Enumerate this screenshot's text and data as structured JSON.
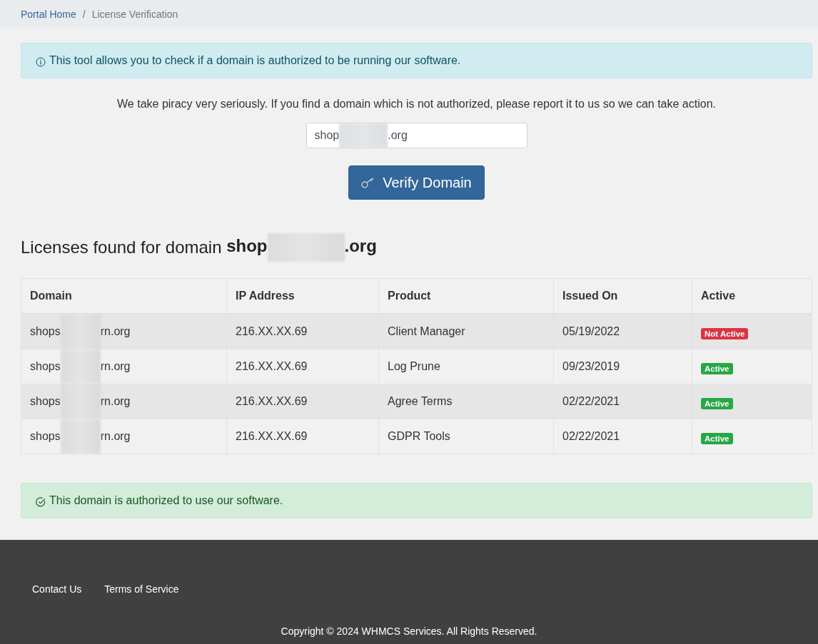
{
  "breadcrumb_separator": "/",
  "breadcrumb": [
    {
      "label": "Portal Home",
      "kind": "link"
    },
    {
      "label": "License Verification",
      "kind": "current"
    }
  ],
  "info_alert": {
    "kind": "info",
    "text": "This tool allows you to check if a domain is authorized to be running our software."
  },
  "notice": "We take piracy very seriously. If you find a domain which is not authorized, please report it to us so we can take action.",
  "domain_field": {
    "value_before": "shop",
    "value_after": ".org"
  },
  "verify_button": "Verify Domain",
  "heading": {
    "text": "Licenses found for domain",
    "domain_before": "shop",
    "domain_after": ".org"
  },
  "table": {
    "columns": [
      "Domain",
      "IP Address",
      "Product",
      "Issued On",
      "Active"
    ],
    "rows": [
      {
        "domain_before": "shops",
        "domain_after": "rn.org",
        "ip": "216.XX.XX.69",
        "product": "Client Manager",
        "issued": "05/19/2022",
        "status": "Not Active",
        "active": false
      },
      {
        "domain_before": "shops",
        "domain_after": "rn.org",
        "ip": "216.XX.XX.69",
        "product": "Log Prune",
        "issued": "09/23/2019",
        "status": "Active",
        "active": true
      },
      {
        "domain_before": "shops",
        "domain_after": "rn.org",
        "ip": "216.XX.XX.69",
        "product": "Agree Terms",
        "issued": "02/22/2021",
        "status": "Active",
        "active": true
      },
      {
        "domain_before": "shops",
        "domain_after": "rn.org",
        "ip": "216.XX.XX.69",
        "product": "GDPR Tools",
        "issued": "02/22/2021",
        "status": "Active",
        "active": true
      }
    ]
  },
  "result_alert": {
    "kind": "success",
    "text": "This domain is authorized to use our software."
  },
  "footer": {
    "links": [
      "Contact Us",
      "Terms of Service"
    ],
    "copyright": "Copyright © 2024 WHMCS Services. All Rights Reserved."
  }
}
